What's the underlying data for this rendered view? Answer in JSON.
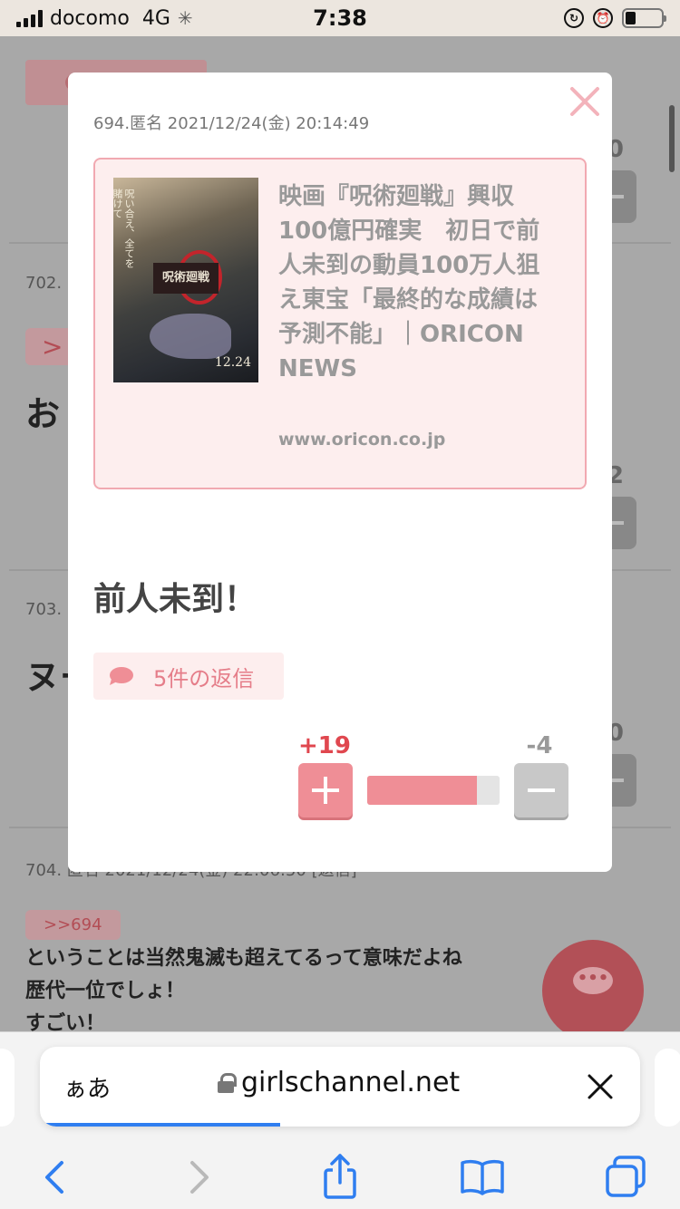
{
  "status_bar": {
    "carrier": "docomo",
    "network": "4G",
    "time": "7:38"
  },
  "background_page": {
    "comments": [
      {
        "meta": "702.",
        "quote": ">",
        "text": "お",
        "count": "2"
      },
      {
        "meta": "703.",
        "text": "ヌー",
        "count": "0"
      },
      {
        "meta": "704. 匿名 2021/12/24(金) 22:06:50 [返信]",
        "quote": ">>694",
        "lines": [
          "ということは当然鬼滅も超えてるって意味だよね",
          "歴代一位でしょ！",
          "すごい！"
        ]
      }
    ],
    "top_count": "0"
  },
  "modal": {
    "meta": "694.匿名 2021/12/24(金) 20:14:49",
    "link_card": {
      "title": "映画『呪術廻戦』興収100億円確実　初日で前人未到の動員100万人狙え東宝「最終的な成績は予測不能」｜ORICON NEWS",
      "domain": "www.oricon.co.jp",
      "poster_title": "呪術廻戦",
      "poster_tagline": "呪い合え、全てを賭けて",
      "poster_date": "12.24"
    },
    "comment": "前人未到！",
    "replies_label": "5件の返信",
    "votes": {
      "plus": "+19",
      "minus": "-4",
      "plus_ratio": 0.83
    }
  },
  "safari": {
    "aa_label": "ぁあ",
    "url": "girlschannel.net",
    "load_progress": 0.4
  },
  "colors": {
    "accent_pink": "#ef8e96",
    "plus_red": "#e0474f",
    "safari_blue": "#2f7ef0"
  }
}
